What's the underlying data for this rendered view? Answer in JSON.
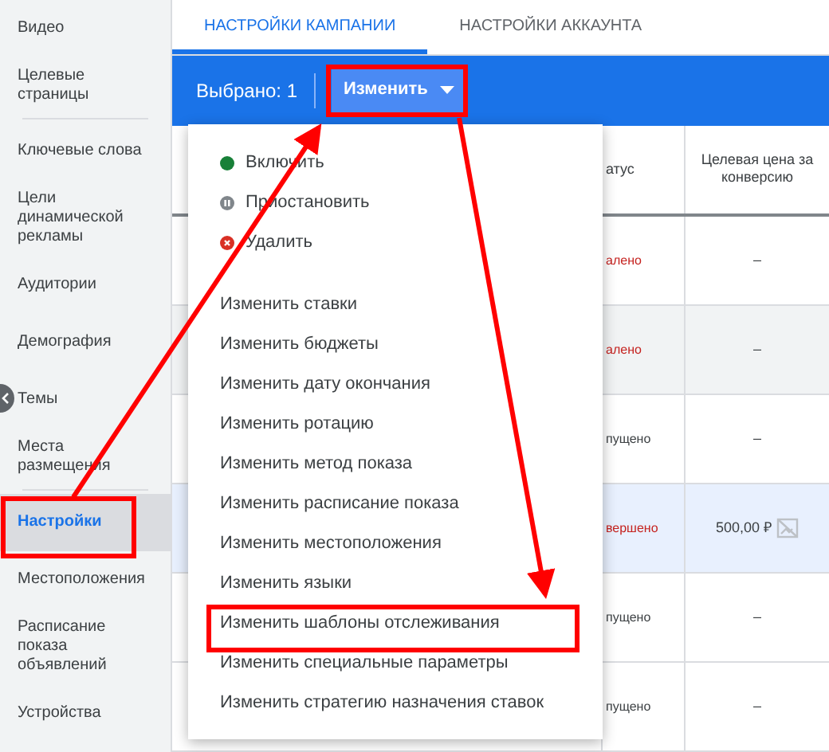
{
  "sidebar": {
    "groups": [
      {
        "items": [
          {
            "label": "Видео",
            "selected": false
          },
          {
            "label": "Целевые страницы",
            "selected": false
          }
        ]
      },
      {
        "items": [
          {
            "label": "Ключевые слова",
            "selected": false
          },
          {
            "label": "Цели динамической рекламы",
            "selected": false
          },
          {
            "label": "Аудитории",
            "selected": false
          },
          {
            "label": "Демография",
            "selected": false
          },
          {
            "label": "Темы",
            "selected": false
          },
          {
            "label": "Места размещения",
            "selected": false
          }
        ]
      },
      {
        "items": [
          {
            "label": "Настройки",
            "selected": true
          },
          {
            "label": "Местоположения",
            "selected": false
          },
          {
            "label": "Расписание показа объявлений",
            "selected": false
          },
          {
            "label": "Устройства",
            "selected": false
          }
        ]
      }
    ]
  },
  "tabs": [
    {
      "label": "НАСТРОЙКИ КАМПАНИИ",
      "selected": true
    },
    {
      "label": "НАСТРОЙКИ АККАУНТА",
      "selected": false
    }
  ],
  "selection_bar": {
    "count": "Выбрано: 1",
    "edit_button": "Изменить"
  },
  "table": {
    "columns": [
      "атус",
      "Целевая цена за конверсию"
    ],
    "rows": [
      {
        "status": "алено",
        "alert": true,
        "target_cpa": "–",
        "hovered": false,
        "selected": false,
        "image_missing": false
      },
      {
        "status": "алено",
        "alert": true,
        "target_cpa": "–",
        "hovered": true,
        "selected": false,
        "image_missing": false
      },
      {
        "status": "пущено",
        "alert": false,
        "target_cpa": "–",
        "hovered": false,
        "selected": false,
        "image_missing": false
      },
      {
        "status": "вершено",
        "alert": true,
        "target_cpa": "500,00 ₽",
        "hovered": false,
        "selected": true,
        "image_missing": true
      },
      {
        "status": "пущено",
        "alert": false,
        "target_cpa": "–",
        "hovered": false,
        "selected": false,
        "image_missing": false
      },
      {
        "status": "пущено",
        "alert": false,
        "target_cpa": "–",
        "hovered": false,
        "selected": false,
        "image_missing": false
      }
    ]
  },
  "menu": {
    "items": [
      {
        "label": "Включить",
        "kind": "enable"
      },
      {
        "label": "Приостановить",
        "kind": "pause"
      },
      {
        "label": "Удалить",
        "kind": "remove"
      },
      {
        "label": "Изменить ставки",
        "kind": "action"
      },
      {
        "label": "Изменить бюджеты",
        "kind": "action"
      },
      {
        "label": "Изменить дату окончания",
        "kind": "action"
      },
      {
        "label": "Изменить ротацию",
        "kind": "action"
      },
      {
        "label": "Изменить метод показа",
        "kind": "action"
      },
      {
        "label": "Изменить расписание показа",
        "kind": "action"
      },
      {
        "label": "Изменить местоположения",
        "kind": "action"
      },
      {
        "label": "Изменить языки",
        "kind": "action"
      },
      {
        "label": "Изменить шаблоны отслеживания",
        "kind": "action"
      },
      {
        "label": "Изменить специальные параметры",
        "kind": "action"
      },
      {
        "label": "Изменить стратегию назначения ставок",
        "kind": "action"
      }
    ]
  }
}
